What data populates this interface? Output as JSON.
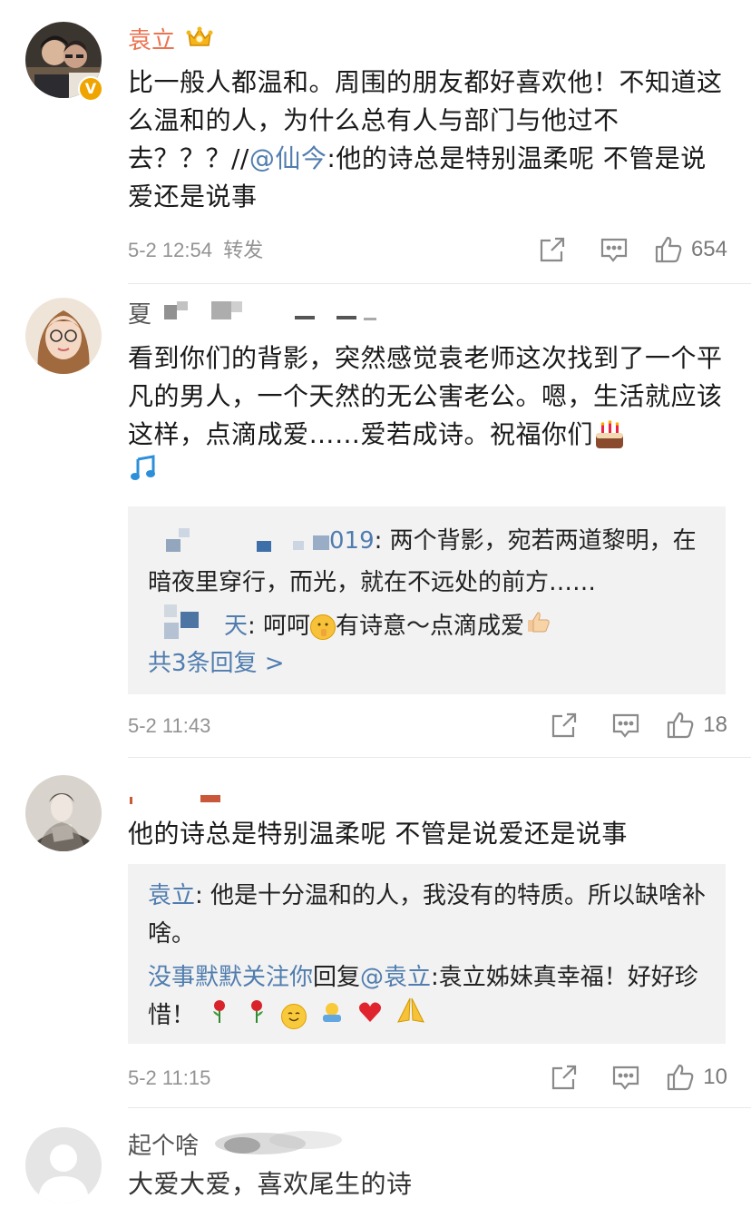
{
  "comments": [
    {
      "name": "袁立",
      "name_badge": "crown-icon",
      "verified": "V",
      "text_plain": "比一般人都温和。周围的朋友都好喜欢他！不知道这么温和的人，为什么总有人与部门与他过不去？？？//",
      "mention": "@仙今",
      "text_after": ":他的诗总是特别温柔呢 不管是说爱还是说事",
      "time": "5-2 12:54",
      "forward_label": "转发",
      "likes": "654"
    },
    {
      "name": "夏",
      "text": "看到你们的背影，突然感觉袁老师这次找到了一个平凡的男人，一个天然的无公害老公。嗯，生活就应该这样，点滴成爱……爱若成诗。祝福你们",
      "replies": [
        {
          "user_suffix": "019",
          "text": ": 两个背影，宛若两道黎明，在暗夜里穿行，而光，就在不远处的前方……"
        },
        {
          "user_suffix": "天",
          "text_a": ": 呵呵",
          "text_b": "有诗意～点滴成爱"
        }
      ],
      "more_replies": "共3条回复 >",
      "time": "5-2 11:43",
      "likes": "18"
    },
    {
      "name": "",
      "text": "他的诗总是特别温柔呢 不管是说爱还是说事",
      "replies": [
        {
          "user": "袁立",
          "text": ": 他是十分温和的人，我没有的特质。所以缺啥补啥。"
        },
        {
          "user": "没事默默关注你",
          "mid": "回复",
          "mention": "@袁立",
          "text": ":袁立姊妹真幸福！好好珍惜！"
        }
      ],
      "time": "5-2 11:15",
      "likes": "10"
    },
    {
      "name": "起个啥",
      "text": "大爱大爱，喜欢尾生的诗"
    }
  ],
  "colors": {
    "name_orange": "#eb7350",
    "link_blue": "#507daf",
    "time_gray": "#939393",
    "reply_bg": "#f2f2f2"
  }
}
